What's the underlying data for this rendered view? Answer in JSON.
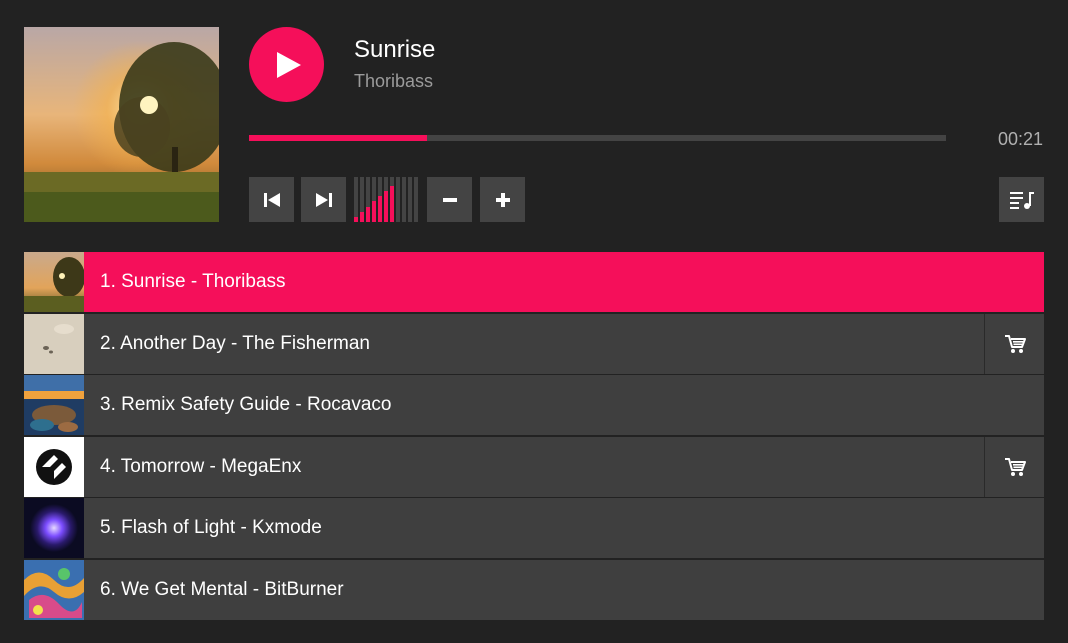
{
  "now_playing": {
    "title": "Sunrise",
    "artist": "Thoribass",
    "elapsed": "00:21",
    "progress": 0.255,
    "volume_level": 0.66
  },
  "controls": {
    "previous_icon": "skip-previous-icon",
    "next_icon": "skip-next-icon",
    "volume_down_icon": "minus-icon",
    "volume_up_icon": "plus-icon",
    "playlist_icon": "playlist-music-icon",
    "play_icon": "play-icon"
  },
  "playlist": [
    {
      "label": "1. Sunrise - Thoribass",
      "active": true,
      "buy": false,
      "thumb": "sunrise-landscape"
    },
    {
      "label": "2. Another Day - The Fisherman",
      "active": false,
      "buy": true,
      "thumb": "beige-sand"
    },
    {
      "label": "3. Remix Safety Guide - Rocavaco",
      "active": false,
      "buy": false,
      "thumb": "coast-sunset"
    },
    {
      "label": "4. Tomorrow - MegaEnx",
      "active": false,
      "buy": true,
      "thumb": "black-white-logo"
    },
    {
      "label": "5. Flash of Light - Kxmode",
      "active": false,
      "buy": false,
      "thumb": "purple-glow"
    },
    {
      "label": "6. We Get Mental - BitBurner",
      "active": false,
      "buy": false,
      "thumb": "graffiti"
    }
  ],
  "colors": {
    "accent": "#f50f5a",
    "background": "#222222",
    "row": "#3f3f3f",
    "button": "#444444",
    "muted_text": "#9b9b9b"
  }
}
